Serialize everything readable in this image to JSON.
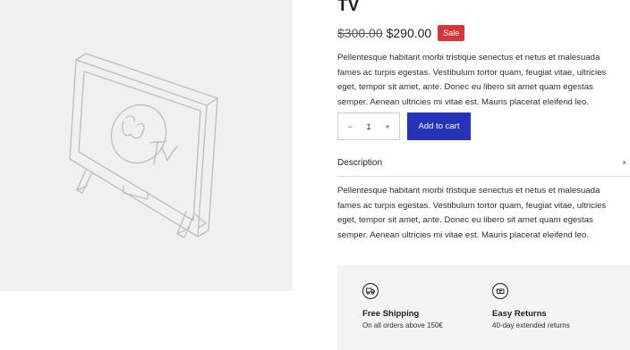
{
  "product": {
    "title": "TV",
    "price_regular": "$300.00",
    "price_sale": "$290.00",
    "sale_badge": "Sale",
    "short_description": "Pellentesque habitant morbi tristique senectus et netus et malesuada fames ac turpis egestas. Vestibulum tortor quam, feugiat vitae, ultricies eget, tempor sit amet, ante. Donec eu libero sit amet quam egestas semper. Aenean ultricies mi vitae est. Mauris placerat eleifend leo."
  },
  "cart": {
    "minus": "−",
    "quantity": "1",
    "plus": "+",
    "add_label": "Add to cart"
  },
  "description": {
    "heading": "Description",
    "close": "×",
    "text": "Pellentesque habitant morbi tristique senectus et netus et malesuada fames ac turpis egestas. Vestibulum tortor quam, feugiat vitae, ultricies eget, tempor sit amet, ante. Donec eu libero sit amet quam egestas semper. Aenean ultricies mi vitae est. Mauris placerat eleifend leo."
  },
  "features": [
    {
      "icon": "truck-icon",
      "title": "Free Shipping",
      "subtitle": "On all orders above 150€"
    },
    {
      "icon": "returns-icon",
      "title": "Easy Returns",
      "subtitle": "40-day extended returns"
    }
  ],
  "colors": {
    "accent": "#2632b8",
    "sale": "#d63638",
    "gallery_bg": "#eff0ef"
  }
}
